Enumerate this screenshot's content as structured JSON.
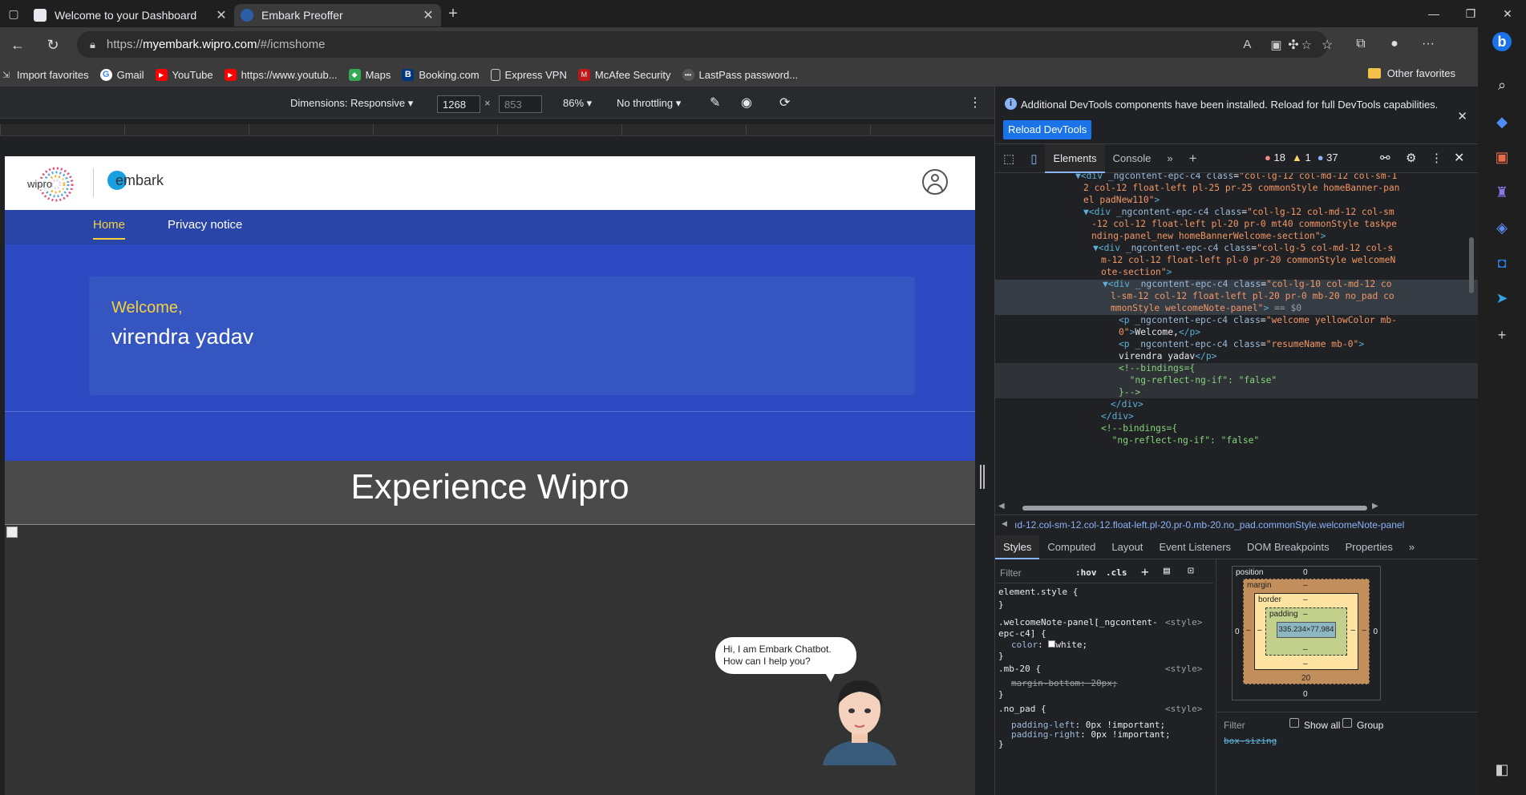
{
  "browser": {
    "tabs": [
      {
        "title": "Welcome to your Dashboard",
        "active": false
      },
      {
        "title": "Embark Preoffer",
        "active": true
      }
    ],
    "url_prefix": "https://",
    "url_host": "myembark.wipro.com",
    "url_path": "/#/icmshome",
    "favorites": [
      {
        "label": "Import favorites",
        "icon": "import-icon"
      },
      {
        "label": "Gmail",
        "icon": "google-icon"
      },
      {
        "label": "YouTube",
        "icon": "youtube-icon"
      },
      {
        "label": "https://www.youtub...",
        "icon": "youtube-icon"
      },
      {
        "label": "Maps",
        "icon": "maps-icon"
      },
      {
        "label": "Booking.com",
        "icon": "booking-icon"
      },
      {
        "label": "Express VPN",
        "icon": "page-icon"
      },
      {
        "label": "McAfee Security",
        "icon": "mcafee-icon"
      },
      {
        "label": "LastPass password...",
        "icon": "lastpass-icon"
      }
    ],
    "other_favorites": "Other favorites"
  },
  "device_toolbar": {
    "dimensions_label": "Dimensions: Responsive",
    "width": "1268",
    "height_placeholder": "853",
    "zoom": "86%",
    "throttling": "No throttling"
  },
  "page": {
    "brand_logo_text": "wipro",
    "embark_text": "embark",
    "nav": {
      "home": "Home",
      "privacy": "Privacy notice"
    },
    "welcome": "Welcome,",
    "user_name": "virendra yadav",
    "experience_title": "Experience Wipro",
    "chatbot_line1": "Hi, I am Embark Chatbot.",
    "chatbot_line2": "How can I help you?"
  },
  "devtools": {
    "info_text": "Additional DevTools components have been installed. Reload for full DevTools capabilities.",
    "reload_button": "Reload DevTools",
    "tabs": {
      "elements": "Elements",
      "console": "Console"
    },
    "errors": "18",
    "warnings": "1",
    "issues": "37",
    "breadcrumb": "ıd-12.col-sm-12.col-12.float-left.pl-20.pr-0.mb-20.no_pad.commonStyle.welcomeNote-panel",
    "style_tabs": [
      "Styles",
      "Computed",
      "Layout",
      "Event Listeners",
      "DOM Breakpoints",
      "Properties"
    ],
    "filter_placeholder": "Filter",
    "hov": ":hov",
    "cls": ".cls",
    "box_model": {
      "position": "position",
      "position_value": "0",
      "margin": "margin",
      "margin_value": "–",
      "border": "border",
      "border_value": "–",
      "padding": "padding",
      "padding_value": "–",
      "content": "335.234×77.984",
      "margin_bottom": "20",
      "position_bottom": "0",
      "position_left": "0",
      "position_right": "0",
      "dash": "–"
    },
    "computed_filter": "Filter",
    "show_all": "Show all",
    "group": "Group",
    "box_sizing_partial": "box-sizing"
  }
}
